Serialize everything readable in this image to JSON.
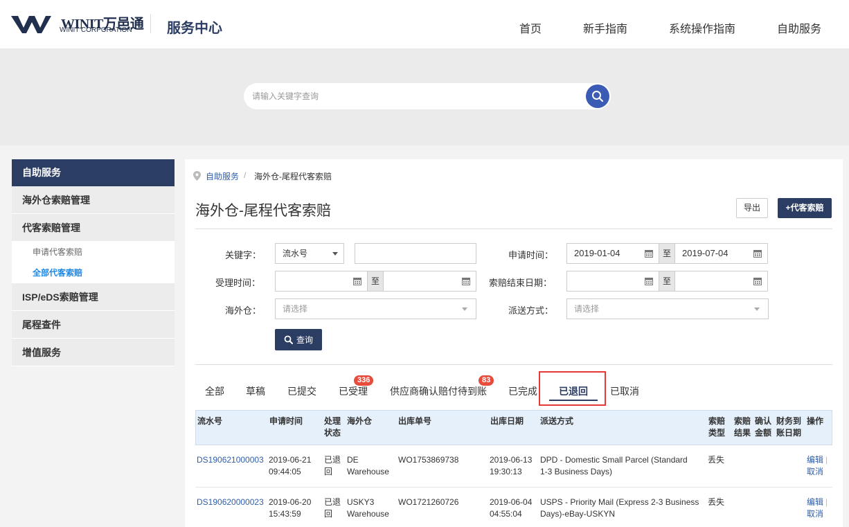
{
  "header": {
    "logo_brand": "WINIT万邑通",
    "logo_sub": "WINIT CORPORATION",
    "site_title": "服务中心",
    "nav": [
      "首页",
      "新手指南",
      "系统操作指南",
      "自助服务"
    ]
  },
  "search": {
    "placeholder": "请输入关键字查询",
    "value": ""
  },
  "sidebar": {
    "title": "自助服务",
    "items": [
      {
        "label": "海外仓索赔管理"
      },
      {
        "label": "代客索赔管理",
        "children": [
          {
            "label": "申请代客索赔",
            "active": false
          },
          {
            "label": "全部代客索赔",
            "active": true
          }
        ]
      },
      {
        "label": "ISP/eDS索赔管理"
      },
      {
        "label": "尾程查件"
      },
      {
        "label": "增值服务"
      }
    ]
  },
  "breadcrumb": {
    "root": "自助服务",
    "separator": "/",
    "current": "海外仓-尾程代客索赔"
  },
  "page": {
    "title": "海外仓-尾程代客索赔",
    "export_label": "导出",
    "add_label": "+代客索赔"
  },
  "filters": {
    "keyword_label": "关键字：",
    "keyword_type": "流水号",
    "keyword_value": "",
    "apply_time_label": "申请时间：",
    "apply_from": "2019-01-04",
    "apply_to": "2019-07-04",
    "to_label": "至",
    "accept_time_label": "受理时间：",
    "accept_from": "",
    "accept_to": "",
    "claim_end_label": "索赔结束日期：",
    "claim_end_from": "",
    "claim_end_to": "",
    "warehouse_label": "海外仓：",
    "warehouse_placeholder": "请选择",
    "delivery_label": "派送方式：",
    "delivery_placeholder": "请选择",
    "query_label": "查询"
  },
  "tabs": [
    {
      "label": "全部"
    },
    {
      "label": "草稿"
    },
    {
      "label": "已提交"
    },
    {
      "label": "已受理",
      "badge": "336"
    },
    {
      "label": "供应商确认赔付待到账",
      "badge": "83"
    },
    {
      "label": "已完成"
    },
    {
      "label": "已退回",
      "active": true
    },
    {
      "label": "已取消"
    }
  ],
  "table": {
    "headers": {
      "serial": "流水号",
      "apply_time": "申请时间",
      "status_1": "处理",
      "status_2": "状态",
      "warehouse": "海外仓",
      "outbound_no": "出库单号",
      "outbound_date": "出库日期",
      "delivery": "派送方式",
      "claim_type_1": "索赔",
      "claim_type_2": "类型",
      "claim_result_1": "索赔",
      "claim_result_2": "结果",
      "confirm_amount_1": "确认",
      "confirm_amount_2": "金额",
      "finance_date_1": "财务到",
      "finance_date_2": "账日期",
      "action": "操作"
    },
    "rows": [
      {
        "serial": "DS190621000003",
        "apply_date": "2019-06-21",
        "apply_clock": "09:44:05",
        "status_1": "已退",
        "status_2": "回",
        "warehouse_1": "DE",
        "warehouse_2": "Warehouse",
        "outbound_no": "WO1753869738",
        "out_date": "2019-06-13",
        "out_clock": "19:30:13",
        "delivery_1": "DPD - Domestic Small Parcel (Standard",
        "delivery_2": "1-3 Business Days)",
        "claim_type": "丢失",
        "edit": "编辑",
        "cancel": "取消"
      },
      {
        "serial": "DS190620000023",
        "apply_date": "2019-06-20",
        "apply_clock": "15:43:59",
        "status_1": "已退",
        "status_2": "回",
        "warehouse_1": "USKY3",
        "warehouse_2": "Warehouse",
        "outbound_no": "WO1721260726",
        "out_date": "2019-06-04",
        "out_clock": "04:55:04",
        "delivery_1": "USPS - Priority Mail (Express 2-3 Business",
        "delivery_2": "Days)-eBay-USKYN",
        "claim_type": "丢失",
        "edit": "编辑",
        "cancel": "取消"
      }
    ]
  },
  "colors": {
    "brand_navy": "#2c3d63",
    "link_blue": "#2e5eaa",
    "badge_red": "#e74c3c",
    "highlight_red": "#e53935"
  }
}
